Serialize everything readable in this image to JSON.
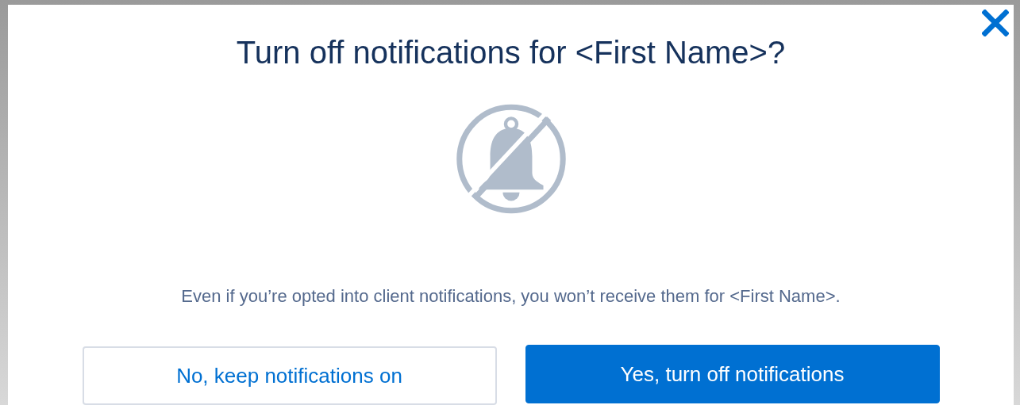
{
  "dialog": {
    "title": "Turn off notifications for <First Name>?",
    "message": "Even if you’re opted into client notifications, you won’t receive them for <First Name>.",
    "buttons": [
      {
        "label": "No, keep notifications on",
        "kind": "neutral"
      },
      {
        "label": "Yes, turn off notifications",
        "kind": "brand"
      }
    ]
  }
}
